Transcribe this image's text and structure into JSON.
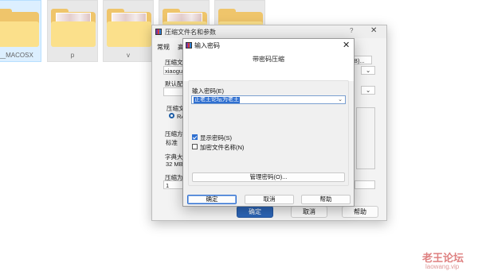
{
  "explorer": {
    "folders": [
      {
        "label": "__MACOSX",
        "selected": true,
        "has_photo": false
      },
      {
        "label": "p",
        "selected": false,
        "has_photo": true
      },
      {
        "label": "v",
        "selected": false,
        "has_photo": true
      },
      {
        "label": "",
        "selected": false,
        "has_photo": true
      },
      {
        "label": "",
        "selected": false,
        "has_photo": false
      }
    ]
  },
  "archive_dialog": {
    "title": "压缩文件名和参数",
    "help_glyph": "?",
    "close_glyph": "✕",
    "tabs": [
      "常规",
      "高"
    ],
    "archive_name_label": "压缩文",
    "archive_name_value": "xiaogu",
    "browse_label": "B)...",
    "default_profile_label": "默认配",
    "format_group_label": "压缩文",
    "format_radio_label": "RA",
    "method_label": "压缩方",
    "method_value": "标准",
    "dict_label": "字典大",
    "dict_value": "32 MB",
    "split_label": "压缩为",
    "split_value": "1",
    "ok_label": "确定",
    "cancel_label": "取消",
    "help_label": "帮助"
  },
  "password_dialog": {
    "title": "输入密码",
    "close_glyph": "✕",
    "header": "带密码压缩",
    "password_label": "输入密码(E)",
    "password_value": "正老王论坛为老王",
    "show_password_label": "显示密码(S)",
    "show_password_checked": true,
    "encrypt_names_label": "加密文件名称(N)",
    "encrypt_names_checked": false,
    "manage_label": "管理密码(O)...",
    "ok_label": "确定",
    "cancel_label": "取消",
    "help_label": "帮助"
  },
  "watermark": {
    "text": "老王论坛",
    "url": "laowang.vip"
  },
  "colors": {
    "accent": "#2f6fd0",
    "folder_yellow": "#f9d35a",
    "watermark": "#d96a6a"
  }
}
